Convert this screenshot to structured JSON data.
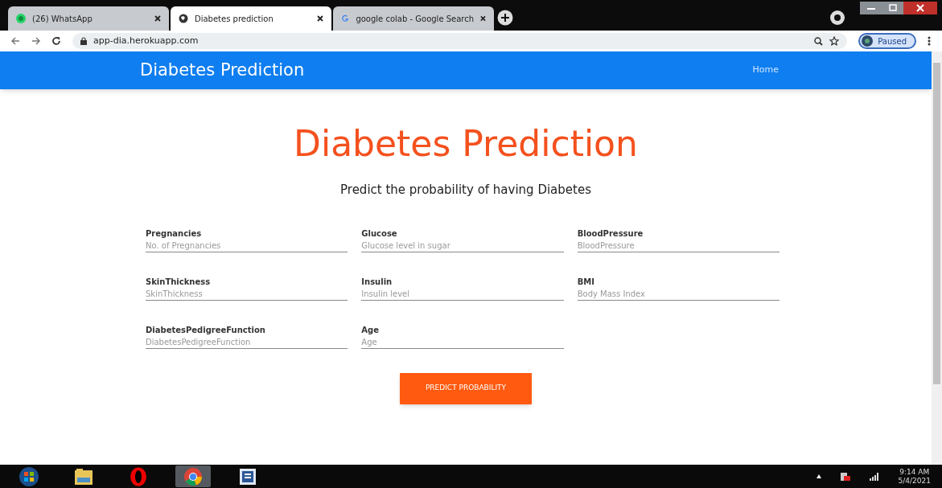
{
  "tabs": [
    {
      "title": "(26) WhatsApp",
      "kind": "whatsapp",
      "selected": false
    },
    {
      "title": "Diabetes prediction",
      "kind": "globe",
      "selected": true
    },
    {
      "title": "google colab - Google Search",
      "kind": "google",
      "selected": false
    }
  ],
  "address": "app-dia.herokuapp.com",
  "profile": "Paused",
  "navbar": {
    "brand": "Diabetes Prediction",
    "links": [
      "Home"
    ]
  },
  "heading": "Diabetes Prediction",
  "subtitle": "Predict the probability of having Diabetes",
  "fields": [
    {
      "label": "Pregnancies",
      "placeholder": "No. of Pregnancies"
    },
    {
      "label": "Glucose",
      "placeholder": "Glucose level in sugar"
    },
    {
      "label": "BloodPressure",
      "placeholder": "BloodPressure"
    },
    {
      "label": "SkinThickness",
      "placeholder": "SkinThickness"
    },
    {
      "label": "Insulin",
      "placeholder": "Insulin level"
    },
    {
      "label": "BMI",
      "placeholder": "Body Mass Index"
    },
    {
      "label": "DiabetesPedigreeFunction",
      "placeholder": "DiabetesPedigreeFunction"
    },
    {
      "label": "Age",
      "placeholder": "Age"
    }
  ],
  "submit": "PREDICT PROBABILITY",
  "taskbar": {
    "apps": [
      {
        "kind": "start",
        "selected": false
      },
      {
        "kind": "folder",
        "selected": false
      },
      {
        "kind": "opera",
        "selected": false
      },
      {
        "kind": "chrome",
        "selected": true
      },
      {
        "kind": "document",
        "selected": false
      }
    ],
    "time": "9:14 AM",
    "date": "5/4/2021"
  }
}
